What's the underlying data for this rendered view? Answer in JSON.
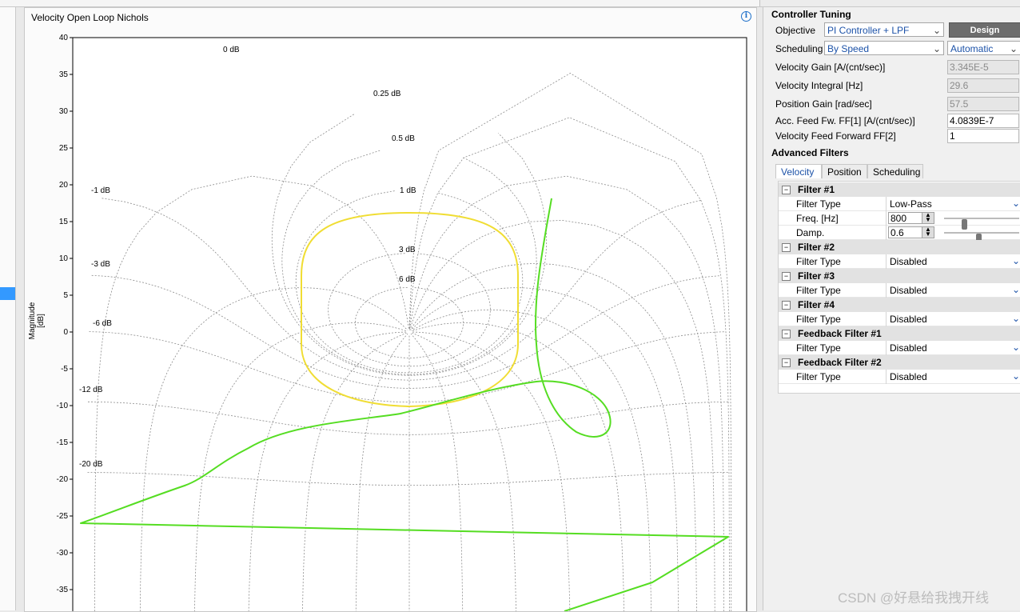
{
  "plot": {
    "title": "Velocity Open Loop Nichols",
    "ylabel": "Magnitude [dB]",
    "yticks": [
      "40",
      "35",
      "30",
      "25",
      "20",
      "15",
      "10",
      "5",
      "0",
      "-5",
      "-10",
      "-15",
      "-20",
      "-25",
      "-30",
      "-35"
    ],
    "contour_labels": [
      "0 dB",
      "0.25 dB",
      "0.5 dB",
      "1 dB",
      "3 dB",
      "6 dB",
      "-1 dB",
      "-3 dB",
      "-6 dB",
      "-12 dB",
      "-20 dB"
    ]
  },
  "controller_tuning": {
    "title": "Controller Tuning",
    "objective_label": "Objective",
    "objective_value": "PI Controller + LPF",
    "design_button": "Design",
    "scheduling_label": "Scheduling",
    "scheduling_value": "By Speed",
    "scheduling_mode": "Automatic",
    "velocity_gain_label": "Velocity Gain [A/(cnt/sec)]",
    "velocity_gain_value": "3.345E-5",
    "velocity_integral_label": "Velocity Integral [Hz]",
    "velocity_integral_value": "29.6",
    "position_gain_label": "Position Gain [rad/sec]",
    "position_gain_value": "57.5",
    "acc_ff_label": "Acc. Feed Fw. FF[1] [A/(cnt/sec)]",
    "acc_ff_value": "4.0839E-7",
    "vel_ff_label": "Velocity Feed Forward FF[2]",
    "vel_ff_value": "1"
  },
  "advanced_filters": {
    "title": "Advanced Filters",
    "tabs": [
      "Velocity",
      "Position",
      "Scheduling"
    ],
    "filter1": {
      "name": "Filter #1",
      "type_label": "Filter Type",
      "type_value": "Low-Pass",
      "freq_label": "Freq. [Hz]",
      "freq_value": "800",
      "damp_label": "Damp.",
      "damp_value": "0.6"
    },
    "filter2": {
      "name": "Filter #2",
      "type_label": "Filter Type",
      "type_value": "Disabled"
    },
    "filter3": {
      "name": "Filter #3",
      "type_label": "Filter Type",
      "type_value": "Disabled"
    },
    "filter4": {
      "name": "Filter #4",
      "type_label": "Filter Type",
      "type_value": "Disabled"
    },
    "fb1": {
      "name": "Feedback Filter #1",
      "type_label": "Filter Type",
      "type_value": "Disabled"
    },
    "fb2": {
      "name": "Feedback Filter #2",
      "type_label": "Filter Type",
      "type_value": "Disabled"
    }
  },
  "watermark": "CSDN @好悬给我拽开线",
  "colors": {
    "accent": "#3399ff",
    "open_loop_curve": "#55dd22",
    "circle_curve": "#f0dd33"
  }
}
